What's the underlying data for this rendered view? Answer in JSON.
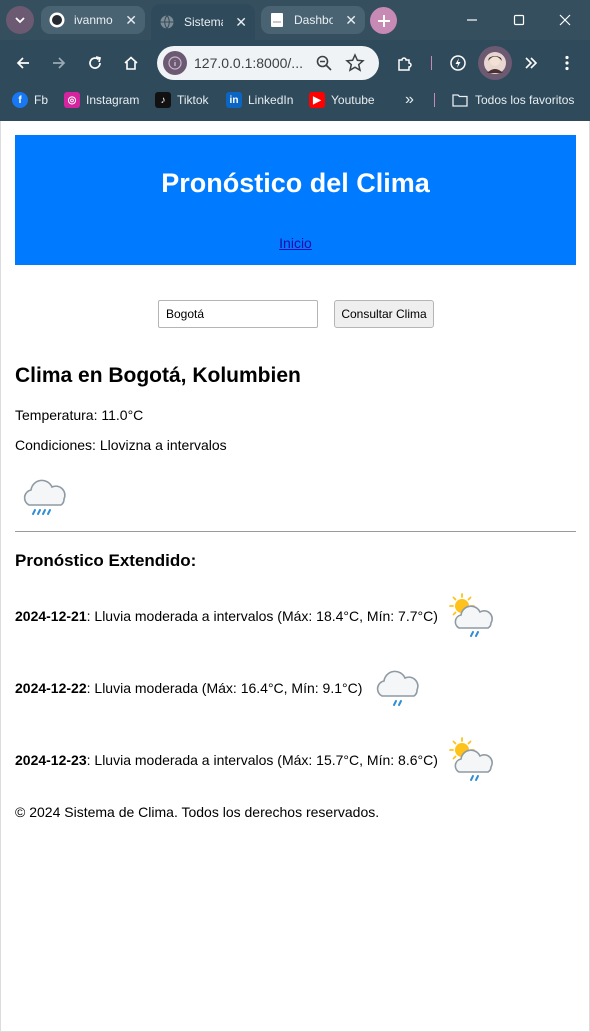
{
  "browser": {
    "tabs": [
      {
        "title": "ivanmo",
        "active": false,
        "icon": "github-icon"
      },
      {
        "title": "Sistema",
        "active": true,
        "icon": "globe-icon"
      },
      {
        "title": "Dashbo",
        "active": false,
        "icon": "document-icon"
      }
    ],
    "url": "127.0.0.1:8000/...",
    "bookmarks": [
      {
        "label": "Fb",
        "icon": "facebook-icon",
        "color": "#1877f2"
      },
      {
        "label": "Instagram",
        "icon": "instagram-icon",
        "color": "#d6249f"
      },
      {
        "label": "Tiktok",
        "icon": "tiktok-icon",
        "color": "#111111"
      },
      {
        "label": "LinkedIn",
        "icon": "linkedin-icon",
        "color": "#0a66c2"
      },
      {
        "label": "Youtube",
        "icon": "youtube-icon",
        "color": "#ff0000"
      }
    ],
    "overflow_label": "»",
    "all_bookmarks_label": "Todos los favoritos"
  },
  "page": {
    "header_title": "Pronóstico del Clima",
    "nav_link": "Inicio",
    "search_value": "Bogotá",
    "search_button": "Consultar Clima",
    "current": {
      "heading": "Clima en Bogotá, Kolumbien",
      "temperature_label": "Temperatura: 11.0°C",
      "conditions_label": "Condiciones: Llovizna a intervalos",
      "icon": "rain-cloud-icon"
    },
    "forecast_heading": "Pronóstico Extendido:",
    "forecast": [
      {
        "date": "2024-12-21",
        "text": ": Lluvia moderada a intervalos (Máx: 18.4°C, Mín: 7.7°C)",
        "icon": "sun-cloud-rain-icon"
      },
      {
        "date": "2024-12-22",
        "text": ": Lluvia moderada (Máx: 16.4°C, Mín: 9.1°C)",
        "icon": "rain-cloud-icon"
      },
      {
        "date": "2024-12-23",
        "text": ": Lluvia moderada a intervalos (Máx: 15.7°C, Mín: 8.6°C)",
        "icon": "sun-cloud-rain-icon"
      }
    ],
    "footer": "© 2024 Sistema de Clima. Todos los derechos reservados.",
    "colors": {
      "header_bg": "#007bff",
      "chrome_bg": "#2f4a5a",
      "link": "#1a0dab"
    }
  }
}
